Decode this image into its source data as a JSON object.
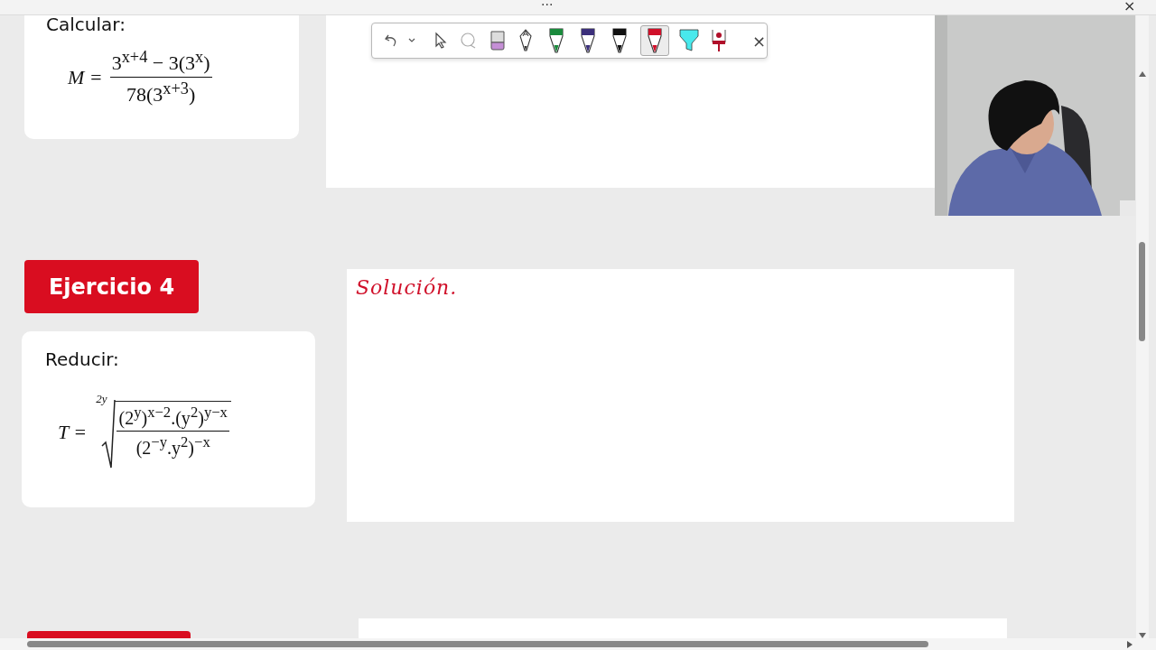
{
  "top_bar": {
    "more": "···",
    "close": "×"
  },
  "toolbar": {
    "tools": [
      {
        "kind": "undo",
        "selected": false
      },
      {
        "kind": "select",
        "selected": false
      },
      {
        "kind": "lasso",
        "selected": false
      },
      {
        "kind": "eraser",
        "selected": false,
        "color": "#c58fd6"
      },
      {
        "kind": "pencil",
        "selected": false
      },
      {
        "kind": "pen",
        "selected": false,
        "color": "#1a8a3c"
      },
      {
        "kind": "pen",
        "selected": false,
        "color": "#3b2f7a"
      },
      {
        "kind": "pen",
        "selected": false,
        "color": "#111111"
      },
      {
        "kind": "pen",
        "selected": true,
        "color": "#d0102a"
      },
      {
        "kind": "highlighter",
        "selected": false,
        "color": "#49e9ec"
      },
      {
        "kind": "stamp",
        "selected": false,
        "color": "#b0102a"
      }
    ],
    "close": "×"
  },
  "exercise_3": {
    "label": "Calcular:",
    "formula": {
      "lhs": "M =",
      "numerator": "3$^{x+4}$ − 3(3$^{x}$)",
      "denominator": "78(3$^{x+3}$)"
    }
  },
  "exercise_4": {
    "badge": "Ejercicio 4",
    "label": "Reducir:",
    "formula": {
      "lhs": "T =",
      "root_index": "2y",
      "numerator": "(2$^{y}$)$^{x−2}$.(y$^{2}$)$^{y−x}$",
      "denominator": "(2$^{−y}$.y$^{2}$)$^{−x}$"
    },
    "solution_note": "Solución."
  }
}
